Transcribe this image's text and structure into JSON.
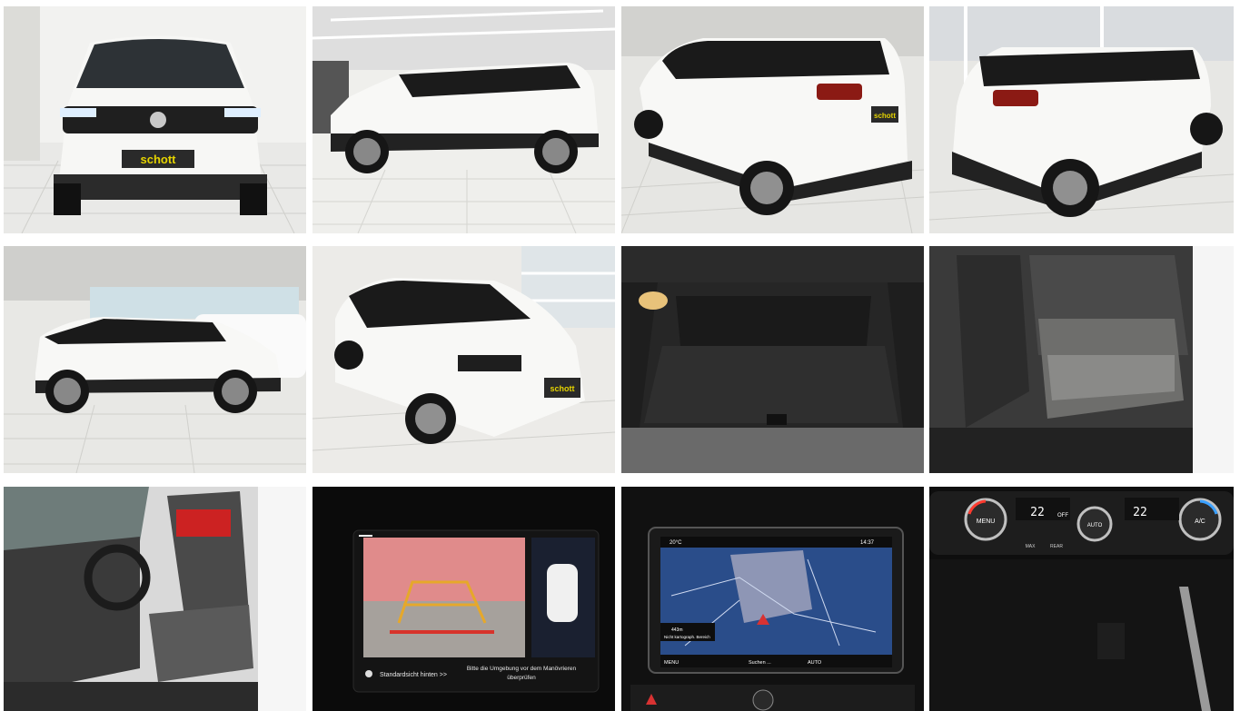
{
  "gallery": {
    "dealer_logo": "schott",
    "photos": [
      {
        "name": "front-view",
        "bg": "#e9e9e7"
      },
      {
        "name": "side-view-right",
        "bg": "#efefec"
      },
      {
        "name": "rear-three-quarter-left",
        "bg": "#e6e6e3"
      },
      {
        "name": "rear-three-quarter-right",
        "bg": "#e7e7e4"
      },
      {
        "name": "side-view-left",
        "bg": "#e8e8e5"
      },
      {
        "name": "front-three-quarter",
        "bg": "#ecebe8"
      },
      {
        "name": "trunk-interior",
        "bg": "#1e1e1e"
      },
      {
        "name": "rear-seats",
        "bg": "#3a3a3a"
      },
      {
        "name": "driver-seat",
        "bg": "#d9d9d9"
      },
      {
        "name": "rear-camera-display",
        "bg": "#0b0b0b"
      },
      {
        "name": "navigation-display",
        "bg": "#111111"
      },
      {
        "name": "climate-controls",
        "bg": "#0e0e0e"
      }
    ]
  },
  "camera_screen": {
    "view_label": "Standardsicht hinten >>",
    "warning_line1": "Bitte die Umgebung vor dem Manövrieren",
    "warning_line2": "überprüfen"
  },
  "nav_screen": {
    "temperature": "20°C",
    "time": "14:37",
    "distance": "443m",
    "area_label": "Nicht kartograph. Bereich",
    "menu": "MENU",
    "search": "Suchen ...",
    "auto": "AUTO"
  },
  "climate": {
    "left_temp": "22",
    "right_temp": "22",
    "off_label": "OFF",
    "menu_label": "MENU",
    "auto_label": "AUTO",
    "ac_label": "A/C",
    "max_label": "MAX",
    "rear_label": "REAR"
  }
}
